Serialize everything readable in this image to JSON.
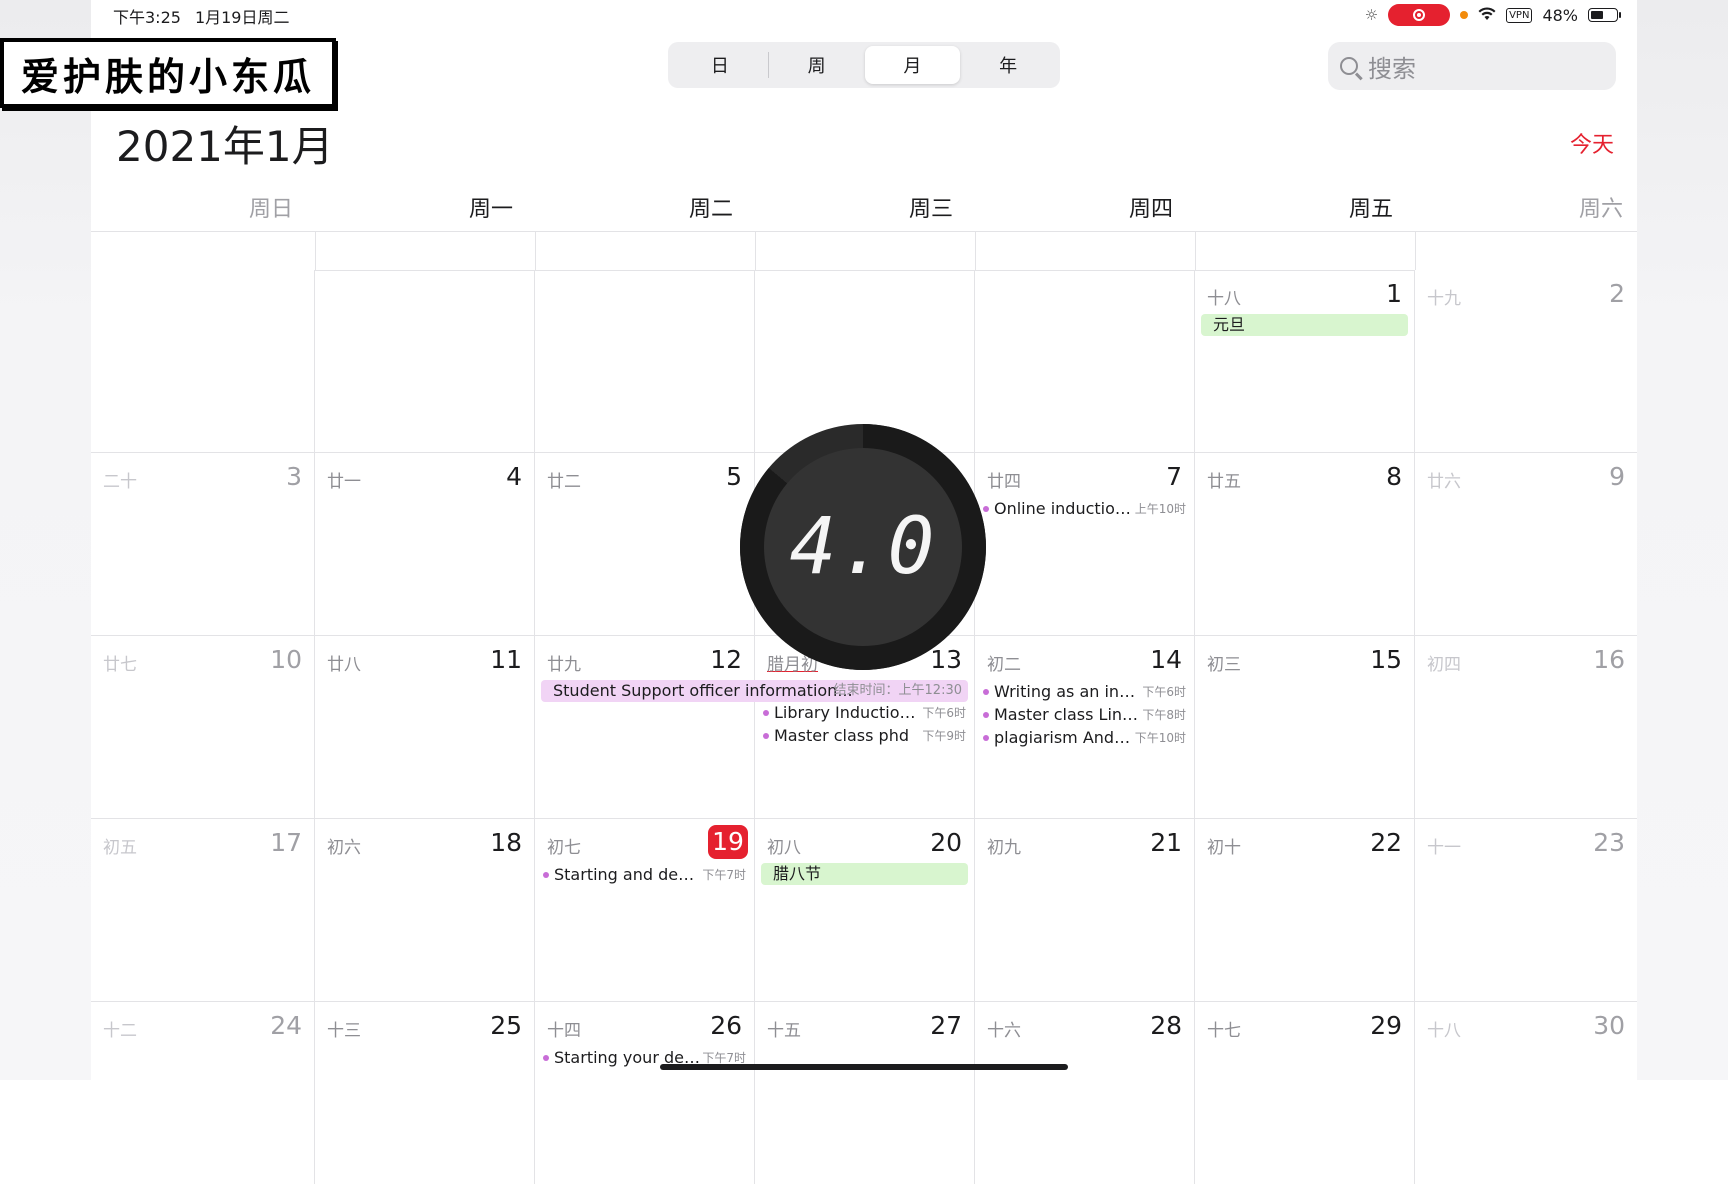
{
  "status_bar": {
    "time": "下午3:25",
    "date": "1月19日周二",
    "vpn": "VPN",
    "battery": "48%"
  },
  "watermark": "爱护肤的小东瓜",
  "view_switcher": {
    "day": "日",
    "week": "周",
    "month": "月",
    "year": "年",
    "selected": "月"
  },
  "search": {
    "placeholder": "搜索"
  },
  "month_title": "2021年1月",
  "today_button": "今天",
  "weekdays": [
    "周日",
    "周一",
    "周二",
    "周三",
    "周四",
    "周五",
    "周六"
  ],
  "overlay": {
    "speed": "4.0"
  },
  "weeks": [
    [
      {
        "lunar": "",
        "day": ""
      },
      {
        "lunar": "",
        "day": ""
      },
      {
        "lunar": "",
        "day": ""
      },
      {
        "lunar": "",
        "day": ""
      },
      {
        "lunar": "",
        "day": ""
      },
      {
        "lunar": "十八",
        "day": "1",
        "allday": "元旦"
      },
      {
        "lunar": "十九",
        "day": "2"
      }
    ],
    [
      {
        "lunar": "二十",
        "day": "3"
      },
      {
        "lunar": "廿一",
        "day": "4"
      },
      {
        "lunar": "廿二",
        "day": "5"
      },
      {
        "lunar": "",
        "day": ""
      },
      {
        "lunar": "廿四",
        "day": "7",
        "events": [
          {
            "title": "Online induction...",
            "time": "上午10时"
          }
        ]
      },
      {
        "lunar": "廿五",
        "day": "8"
      },
      {
        "lunar": "廿六",
        "day": "9"
      }
    ],
    [
      {
        "lunar": "廿七",
        "day": "10"
      },
      {
        "lunar": "廿八",
        "day": "11"
      },
      {
        "lunar": "廿九",
        "day": "12",
        "span_event": {
          "title": "Student Support officer information...",
          "end_label": "结束时间：上午12:30"
        }
      },
      {
        "lunar": "腊月初",
        "day": "13",
        "events": [
          {
            "title": "Library Induction...",
            "time": "下午6时"
          },
          {
            "title": "Master class phd",
            "time": "下午9时"
          }
        ]
      },
      {
        "lunar": "初二",
        "day": "14",
        "events": [
          {
            "title": "Writing as an inte...",
            "time": "下午6时"
          },
          {
            "title": "Master class Link...",
            "time": "下午8时"
          },
          {
            "title": "plagiarism And t...",
            "time": "下午10时"
          }
        ]
      },
      {
        "lunar": "初三",
        "day": "15"
      },
      {
        "lunar": "初四",
        "day": "16"
      }
    ],
    [
      {
        "lunar": "初五",
        "day": "17"
      },
      {
        "lunar": "初六",
        "day": "18"
      },
      {
        "lunar": "初七",
        "day": "19",
        "today": true,
        "events": [
          {
            "title": "Starting and deve...",
            "time": "下午7时"
          }
        ]
      },
      {
        "lunar": "初八",
        "day": "20",
        "allday": "腊八节"
      },
      {
        "lunar": "初九",
        "day": "21"
      },
      {
        "lunar": "初十",
        "day": "22"
      },
      {
        "lunar": "十一",
        "day": "23"
      }
    ],
    [
      {
        "lunar": "十二",
        "day": "24"
      },
      {
        "lunar": "十三",
        "day": "25"
      },
      {
        "lunar": "十四",
        "day": "26",
        "events": [
          {
            "title": "Starting your dest...",
            "time": "下午7时"
          }
        ]
      },
      {
        "lunar": "十五",
        "day": "27"
      },
      {
        "lunar": "十六",
        "day": "28"
      },
      {
        "lunar": "十七",
        "day": "29"
      },
      {
        "lunar": "十八",
        "day": "30"
      }
    ]
  ]
}
